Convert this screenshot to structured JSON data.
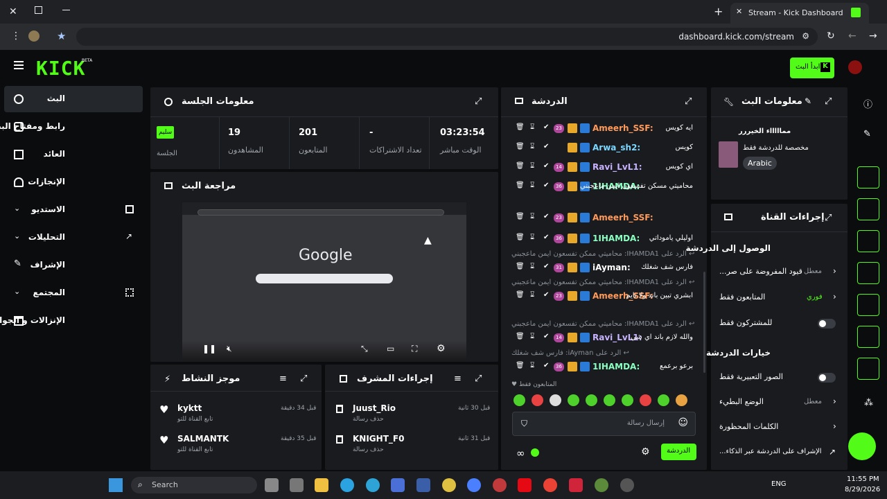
{
  "browser": {
    "tab_title": "Stream - Kick Dashboard",
    "url": "dashboard.kick.com/stream"
  },
  "header": {
    "logo": "KICK",
    "beta": "BETA",
    "go_live": "ابدأ البث"
  },
  "sidebar": {
    "items": [
      {
        "label": "البث"
      },
      {
        "label": "رابط ومفتاح البث"
      },
      {
        "label": "العائد"
      },
      {
        "label": "الإنجازات"
      },
      {
        "label": "الاستديو"
      },
      {
        "label": "التحليلات"
      },
      {
        "label": "الإشراف"
      },
      {
        "label": "المجتمع"
      },
      {
        "label": "الإنزالات و الجوائز"
      }
    ]
  },
  "session": {
    "title": "معلومات الجلسة",
    "status_badge": "سليم",
    "status_label": "الجلسة",
    "stats": [
      {
        "value": "19",
        "label": "المشاهدون"
      },
      {
        "value": "201",
        "label": "المتابعون"
      },
      {
        "value": "-",
        "label": "تعداد الاشتراكات"
      },
      {
        "value": "03:23:54",
        "label": "الوقت مباشر"
      }
    ]
  },
  "preview": {
    "title": "مراجعة البث",
    "google": "Google"
  },
  "activity": {
    "title": "موجز النشاط",
    "items": [
      {
        "user": "kyktt",
        "action": "تابع القناة للتو",
        "time": "قبل 34 دقيقة"
      },
      {
        "user": "SALMANTK",
        "action": "تابع القناة للتو",
        "time": "قبل 35 دقيقة"
      }
    ]
  },
  "mod_actions": {
    "title": "إجراءات المشرف",
    "items": [
      {
        "user": "Juust_Rio",
        "action": "حذف رسالة",
        "time": "قبل 30 ثانية"
      },
      {
        "user": "KNIGHT_F0",
        "action": "حذف رسالة",
        "time": "قبل 31 ثانية"
      }
    ]
  },
  "chat": {
    "title": "الدردشة",
    "messages": [
      {
        "user": "Ameerh_SSF",
        "text": "ايه كويس",
        "badge": "23",
        "color": "#ff9a5a"
      },
      {
        "user": "Arwa_sh2",
        "text": "كويس",
        "badge": "",
        "color": "#7bd7ff"
      },
      {
        "user": "Ravi_LvL1",
        "text": "اي كويس",
        "badge": "14",
        "color": "#c9b3ff"
      },
      {
        "user": "1IHAMDA",
        "text": "محاميتي مسكن تفسعون ايمن ماعجبني",
        "badge": "36",
        "color": "#8affc1"
      },
      {
        "user": "Ameerh_SSF",
        "text": "",
        "badge": "23",
        "color": "#ff9a5a"
      },
      {
        "user": "1IHAMDA",
        "text": "اوليلي ياموداتي",
        "badge": "36",
        "color": "#8affc1"
      },
      {
        "user": "iAyman",
        "text": "فارس شف شغلك",
        "badge": "31",
        "color": "#ffffff",
        "reply": "الرد على IHAMDA1: محاميتي ممكن تفسعون ايمن ماعجبني"
      },
      {
        "user": "Ameerh_SSF",
        "text": "ابشري تبين باند ولا تايم",
        "badge": "23",
        "color": "#ff9a5a",
        "reply": "الرد على IHAMDA1: محاميتي ممكن تفسعون ايمن ماعجبني"
      },
      {
        "user": "Ravi_LvL1",
        "text": "والله لازم باند اي شي",
        "badge": "14",
        "color": "#c9b3ff",
        "reply": "الرد على IHAMDA1: محاميتي ممكن تفسعون ايمن ماعجبني"
      },
      {
        "user": "1IHAMDA",
        "text": "برعو برعمع",
        "badge": "36",
        "color": "#8affc1",
        "reply": "الرد على iAyman: فارس شف شغلك"
      }
    ],
    "followers_only": "المتابعون فقط",
    "input_placeholder": "إرسال رسالة",
    "send_label": "الدردشة"
  },
  "stream_info": {
    "title": "معلومات البث",
    "stream_title": "مماااااء الخيررر",
    "category": "مخصصة للدردشة فقط",
    "language": "Arabic"
  },
  "channel_actions": {
    "title": "إجراءات القناة",
    "sections": [
      {
        "heading": "الوصول إلى الدردشة"
      },
      {
        "heading": "خيارات الدردشة"
      }
    ],
    "rows": [
      {
        "label": "قيود المفروضة على صر...",
        "value": "معطل"
      },
      {
        "label": "المتابعون فقط",
        "value": "فوري"
      },
      {
        "label": "للمشتركون فقط",
        "value": ""
      },
      {
        "label": "الصور التعبيرية فقط",
        "value": ""
      },
      {
        "label": "الوضع البطيء",
        "value": "معطل"
      },
      {
        "label": "الكلمات المحظورة",
        "value": ""
      },
      {
        "label": "الإشراف على الدردشة عبر الذكاء...",
        "value": ""
      }
    ]
  },
  "taskbar": {
    "search": "Search",
    "lang": "ENG",
    "time": "11:55 PM",
    "date": "8/29/2026"
  },
  "colors": {
    "accent": "#53fc18",
    "panel": "#191b1f"
  }
}
